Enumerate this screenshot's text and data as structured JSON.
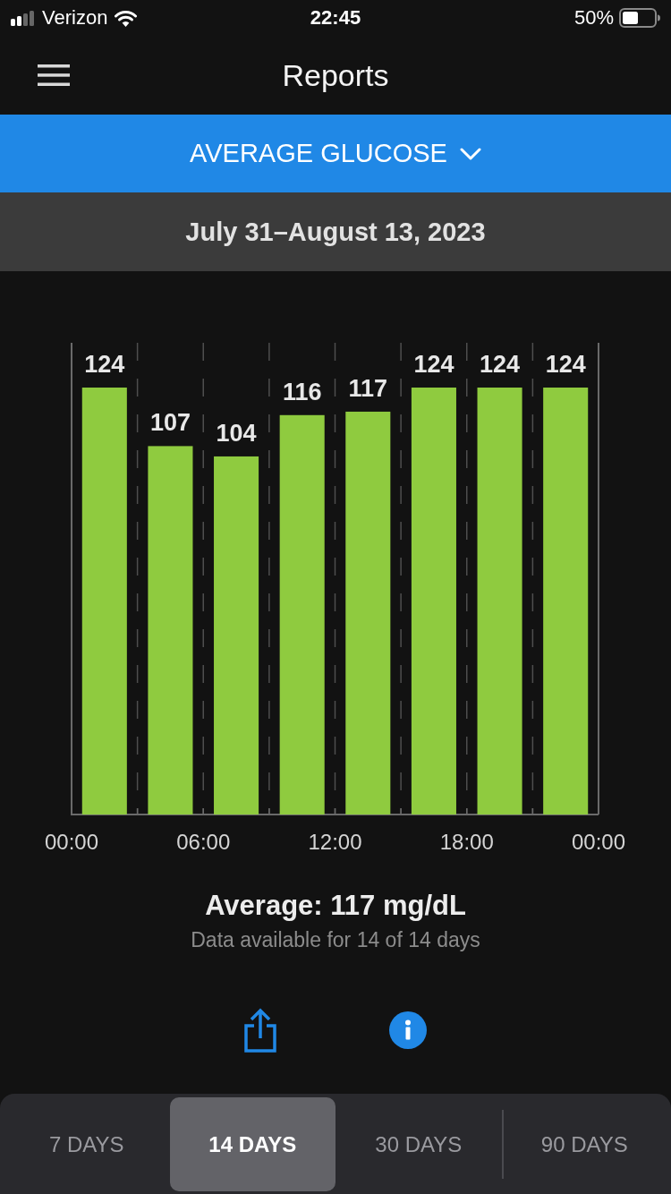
{
  "status_bar": {
    "carrier": "Verizon",
    "time": "22:45",
    "battery": "50%"
  },
  "header": {
    "title": "Reports"
  },
  "report_selector": {
    "label": "AVERAGE GLUCOSE"
  },
  "date_range": "July 31–August 13, 2023",
  "chart": {
    "chart_data": {
      "type": "bar",
      "x": [
        1.5,
        4.5,
        7.5,
        10.5,
        13.5,
        16.5,
        19.5,
        22.5
      ],
      "values": [
        124,
        107,
        104,
        116,
        117,
        124,
        124,
        124
      ],
      "xlim": [
        0,
        24
      ],
      "ylim": [
        0,
        137
      ],
      "xticks": [
        {
          "value": 0,
          "label": "00:00"
        },
        {
          "value": 6,
          "label": "06:00"
        },
        {
          "value": 12,
          "label": "12:00"
        },
        {
          "value": 18,
          "label": "18:00"
        },
        {
          "value": 24,
          "label": "00:00"
        }
      ],
      "grid": true,
      "data_labels": true
    }
  },
  "summary": {
    "average": "Average: 117 mg/dL",
    "availability": "Data available for 14 of 14 days"
  },
  "period_tabs": [
    {
      "label": "7 DAYS",
      "selected": false
    },
    {
      "label": "14 DAYS",
      "selected": true
    },
    {
      "label": "30 DAYS",
      "selected": false
    },
    {
      "label": "90 DAYS",
      "selected": false
    }
  ]
}
